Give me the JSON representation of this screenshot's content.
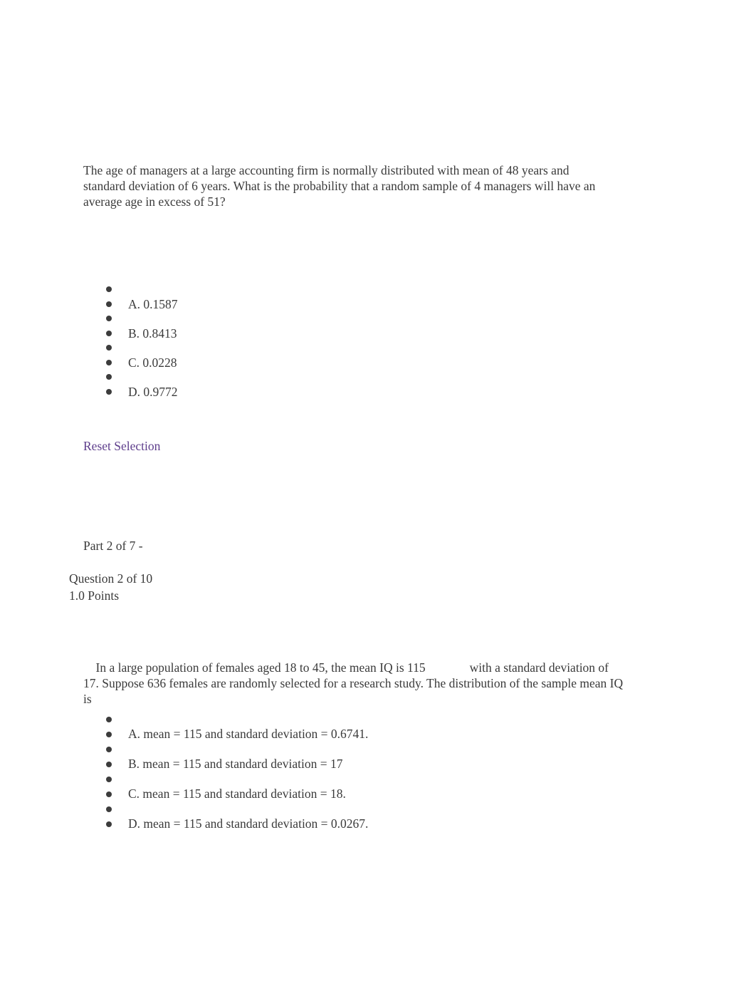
{
  "document": {
    "background_color": "#ffffff",
    "text_color": "#3a3a3a",
    "link_color": "#5e3e8c"
  },
  "question_1": {
    "prompt": "The age of managers at a large accounting firm is normally distributed with mean of 48 years and standard deviation of 6 years. What is the probability that a random sample of 4 managers will have an average age in excess of 51?",
    "options": [
      {
        "label": "A. 0.1587"
      },
      {
        "label": "B. 0.8413"
      },
      {
        "label": "C. 0.0228"
      },
      {
        "label": "D. 0.9772"
      }
    ],
    "reset_label": "Reset Selection"
  },
  "section": {
    "part_label": "Part 2 of 7 -",
    "question_number": "Question 2 of 10",
    "points_label": "1.0 Points"
  },
  "question_2": {
    "prompt_part_1": "In a large population of females aged 18 to 45, the mean IQ is 115",
    "prompt_part_2": "with a standard deviation of 17. Suppose 636 females are randomly selected for a research study. The distribution of the sample mean IQ is",
    "options": [
      {
        "label": "A. mean = 115 and standard deviation = 0.6741."
      },
      {
        "label": "B. mean = 115 and standard deviation = 17"
      },
      {
        "label": "C. mean = 115 and standard deviation = 18."
      },
      {
        "label": "D. mean = 115 and standard deviation = 0.0267."
      }
    ]
  }
}
